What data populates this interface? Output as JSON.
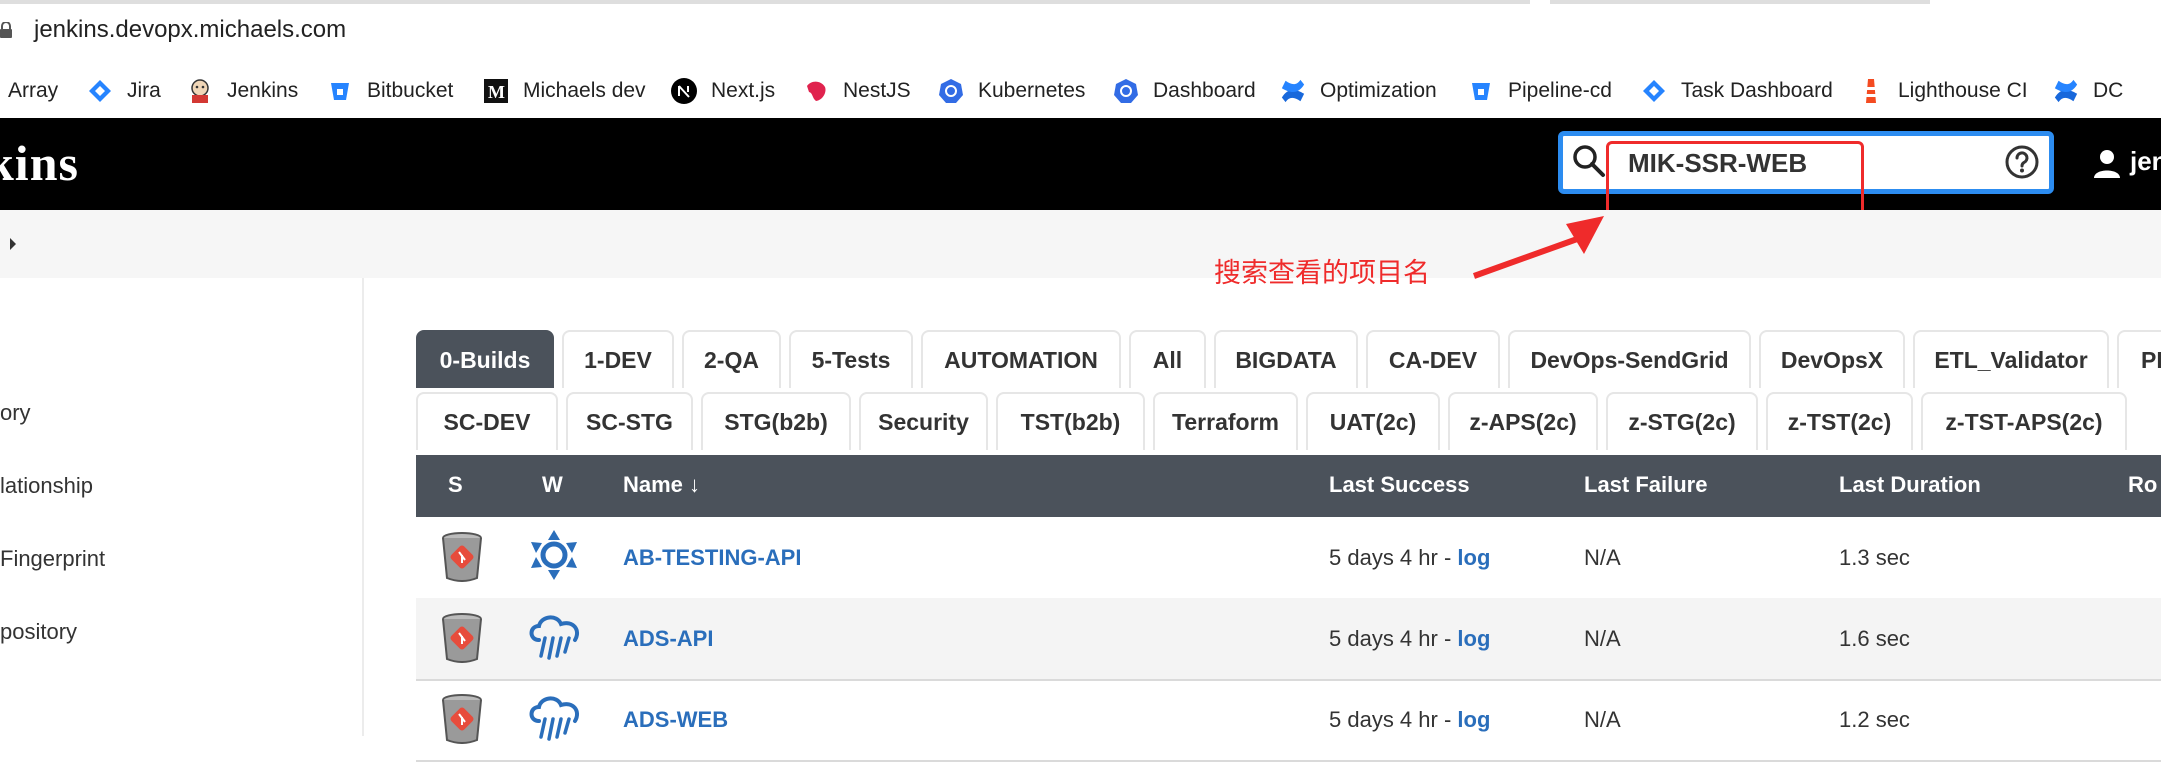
{
  "browser": {
    "url": "jenkins.devopx.michaels.com"
  },
  "bookmarks": [
    {
      "label": "Array",
      "icon": "none"
    },
    {
      "label": "Jira",
      "icon": "jira-icon"
    },
    {
      "label": "Jenkins",
      "icon": "jenkins-icon"
    },
    {
      "label": "Bitbucket",
      "icon": "bitbucket-icon"
    },
    {
      "label": "Michaels dev",
      "icon": "michaels-icon"
    },
    {
      "label": "Next.js",
      "icon": "nextjs-icon"
    },
    {
      "label": "NestJS",
      "icon": "nestjs-icon"
    },
    {
      "label": "Kubernetes",
      "icon": "kubernetes-icon"
    },
    {
      "label": "Dashboard",
      "icon": "kubernetes-icon"
    },
    {
      "label": "Optimization",
      "icon": "confluence-icon"
    },
    {
      "label": "Pipeline-cd",
      "icon": "bitbucket-icon"
    },
    {
      "label": "Task Dashboard",
      "icon": "jira-icon"
    },
    {
      "label": "Lighthouse CI",
      "icon": "lighthouse-icon"
    },
    {
      "label": "DC",
      "icon": "confluence-icon"
    }
  ],
  "header": {
    "logo": "kins",
    "search_value": "MIK-SSR-WEB",
    "user": "jen"
  },
  "annotation": {
    "text": "搜索查看的项目名"
  },
  "sidebar": {
    "items": [
      "ory",
      "lationship",
      " Fingerprint",
      "pository"
    ]
  },
  "tabs": {
    "row1": [
      "0-Builds",
      "1-DEV",
      "2-QA",
      "5-Tests",
      "AUTOMATION",
      "All",
      "BIGDATA",
      "CA-DEV",
      "DevOps-SendGrid",
      "DevOpsX",
      "ETL_Validator",
      "PI"
    ],
    "row2": [
      "SC-DEV",
      "SC-STG",
      "STG(b2b)",
      "Security",
      "TST(b2b)",
      "Terraform",
      "UAT(2c)",
      "z-APS(2c)",
      "z-STG(2c)",
      "z-TST(2c)",
      "z-TST-APS(2c)"
    ],
    "active": "0-Builds"
  },
  "table": {
    "columns": [
      "S",
      "W",
      "Name ↓",
      "Last Success",
      "Last Failure",
      "Last Duration",
      "Ro"
    ],
    "rows": [
      {
        "name": "AB-TESTING-API",
        "weather": "sunny-icon",
        "last_success": "5 days 4 hr - ",
        "log": "log",
        "last_failure": "N/A",
        "last_duration": "1.3 sec"
      },
      {
        "name": "ADS-API",
        "weather": "rain-icon",
        "last_success": "5 days 4 hr - ",
        "log": "log",
        "last_failure": "N/A",
        "last_duration": "1.6 sec"
      },
      {
        "name": "ADS-WEB",
        "weather": "rain-icon",
        "last_success": "5 days 4 hr - ",
        "log": "log",
        "last_failure": "N/A",
        "last_duration": "1.2 sec"
      }
    ]
  },
  "colors": {
    "header_bg": "#000000",
    "search_border": "#2c8cf0",
    "annotation": "#ef2b2b",
    "tab_active": "#4b525b",
    "link": "#2a6ebb"
  }
}
